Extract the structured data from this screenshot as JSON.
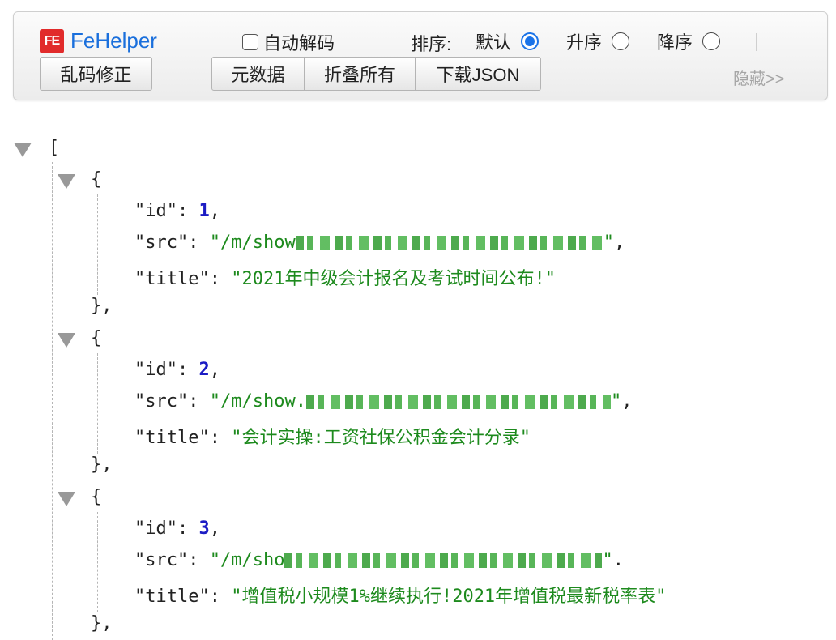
{
  "toolbar": {
    "logo_badge": "FE",
    "logo_text": "FeHelper",
    "auto_decode_label": "自动解码",
    "sort_label": "排序:",
    "sort_options": [
      "默认",
      "升序",
      "降序"
    ],
    "sort_selected": "默认",
    "fix_garbled_label": "乱码修正",
    "meta_label": "元数据",
    "fold_all_label": "折叠所有",
    "download_label": "下载JSON",
    "hide_label": "隐藏>>",
    "accent_color": "#1a73e8",
    "logo_color": "#1a6fdc"
  },
  "json_view": {
    "open_bracket": "[",
    "items": [
      {
        "id": "1",
        "src_prefix": "\"/m/show",
        "title": "\"2021年中级会计报名及考试时间公布!\""
      },
      {
        "id": "2",
        "src_prefix": "\"/m/show.",
        "title": "\"会计实操:工资社保公积金会计分录\""
      },
      {
        "id": "3",
        "src_prefix": "\"/m/sho",
        "title": "\"增值税小规模1%继续执行!2021年增值税最新税率表\""
      }
    ],
    "key_id": "\"id\"",
    "key_src": "\"src\"",
    "key_title": "\"title\"",
    "colors": {
      "number": "#1c1cc4",
      "string": "#1d8a1d"
    }
  }
}
